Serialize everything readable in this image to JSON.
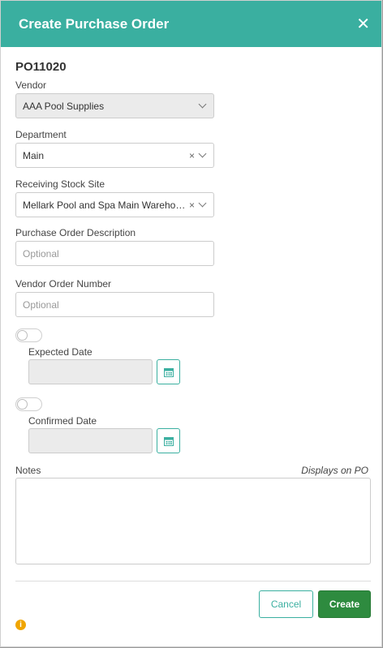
{
  "dialog": {
    "title": "Create Purchase Order",
    "close_glyph": "✕"
  },
  "po_number": "PO11020",
  "vendor": {
    "label": "Vendor",
    "value": "AAA Pool Supplies"
  },
  "department": {
    "label": "Department",
    "value": "Main"
  },
  "stock_site": {
    "label": "Receiving Stock Site",
    "value": "Mellark Pool and Spa Main Warehouse"
  },
  "description": {
    "label": "Purchase Order Description",
    "placeholder": "Optional"
  },
  "vendor_order_number": {
    "label": "Vendor Order Number",
    "placeholder": "Optional"
  },
  "expected_date": {
    "label": "Expected Date",
    "value": "",
    "toggle_on": false
  },
  "confirmed_date": {
    "label": "Confirmed Date",
    "value": "",
    "toggle_on": false
  },
  "notes": {
    "label": "Notes",
    "hint": "Displays on PO",
    "value": ""
  },
  "buttons": {
    "cancel": "Cancel",
    "create": "Create"
  },
  "icons": {
    "clear": "×",
    "info": "i"
  },
  "colors": {
    "header": "#3aafa0",
    "create_button": "#2e8b3f",
    "info_icon": "#f0a500"
  }
}
